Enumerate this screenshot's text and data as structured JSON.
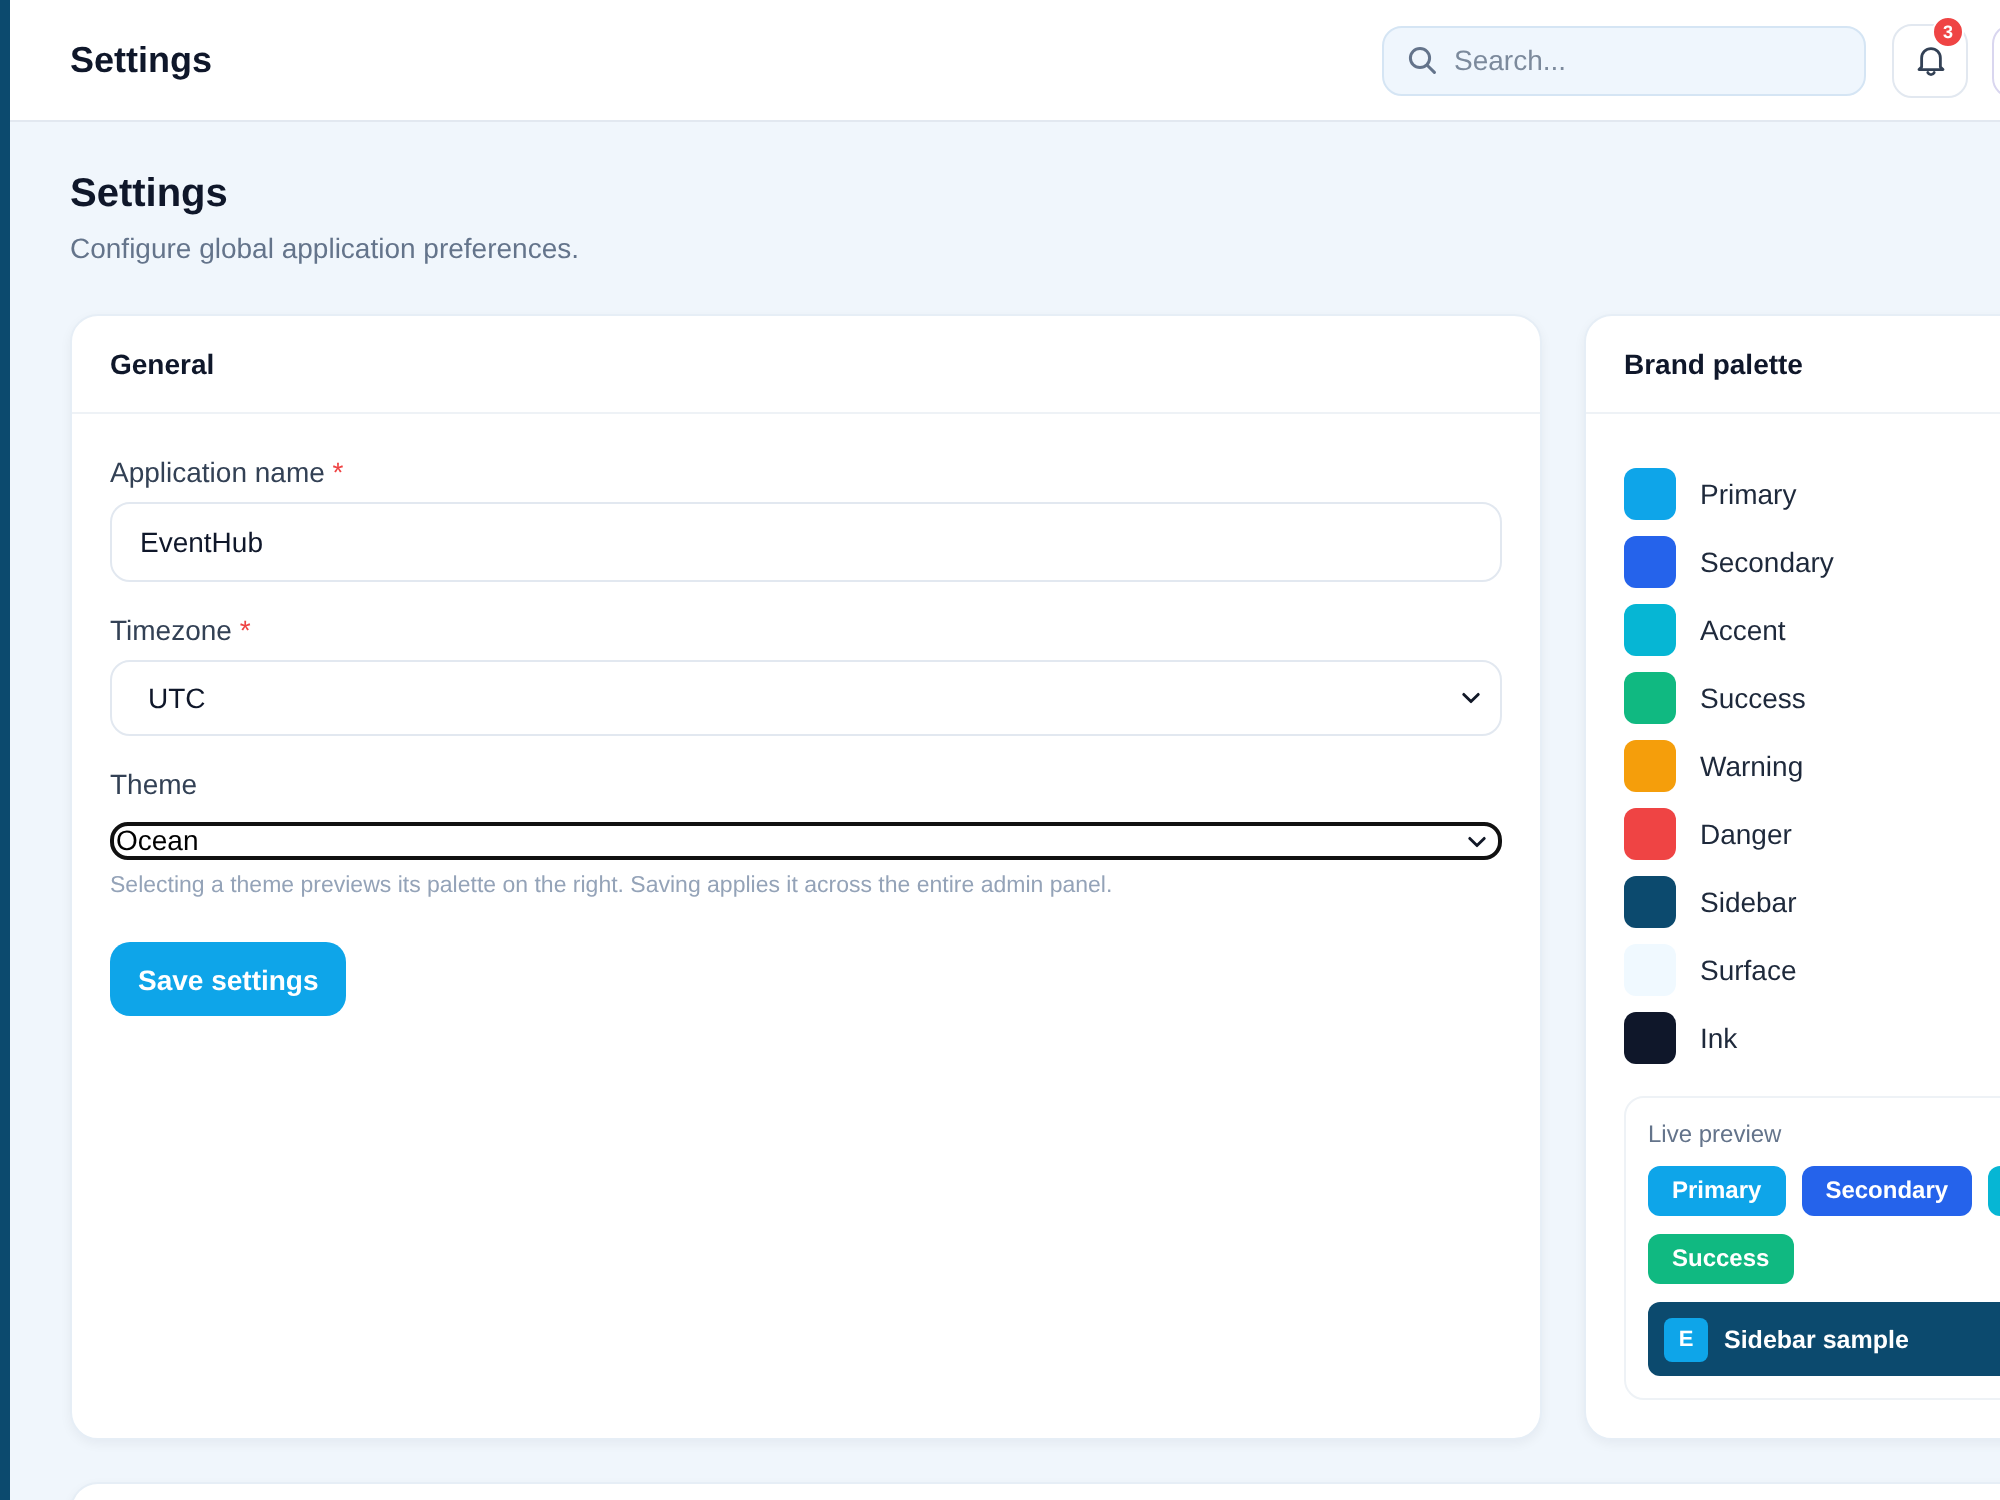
{
  "header": {
    "title": "Settings",
    "search": {
      "placeholder": "Search..."
    },
    "notifications": {
      "count": "3"
    }
  },
  "page": {
    "title": "Settings",
    "subtitle": "Configure global application preferences."
  },
  "general": {
    "title": "General",
    "fields": [
      {
        "kind": "text",
        "label": "Application name",
        "required_mark": "*",
        "value": "EventHub"
      },
      {
        "kind": "select",
        "label": "Timezone",
        "required_mark": "*",
        "value": "UTC"
      },
      {
        "kind": "native_select",
        "label": "Theme",
        "value": "Ocean",
        "hint": "Selecting a theme previews its palette on the right. Saving applies it across the entire admin panel."
      }
    ],
    "save_button": "Save settings"
  },
  "brand_palette": {
    "title": "Brand palette",
    "swatches": [
      {
        "label": "Primary",
        "color": "#0ea5e9"
      },
      {
        "label": "Secondary",
        "color": "#2563eb"
      },
      {
        "label": "Accent",
        "color": "#06b6d4"
      },
      {
        "label": "Success",
        "color": "#10b981"
      },
      {
        "label": "Warning",
        "color": "#f59e0b"
      },
      {
        "label": "Danger",
        "color": "#ef4444"
      },
      {
        "label": "Sidebar",
        "color": "#0c4a6e"
      },
      {
        "label": "Surface",
        "color": "#f0f9ff"
      },
      {
        "label": "Ink",
        "color": "#0f172a"
      }
    ],
    "preview": {
      "title": "Live preview",
      "chips": [
        {
          "label": "Primary",
          "color": "#0ea5e9"
        },
        {
          "label": "Secondary",
          "color": "#2563eb"
        },
        {
          "color": "#06b6d4"
        },
        {
          "label": "Success",
          "color": "#10b981"
        }
      ],
      "sidebar_sample": {
        "initial": "E",
        "label": "Sidebar sample"
      }
    }
  }
}
